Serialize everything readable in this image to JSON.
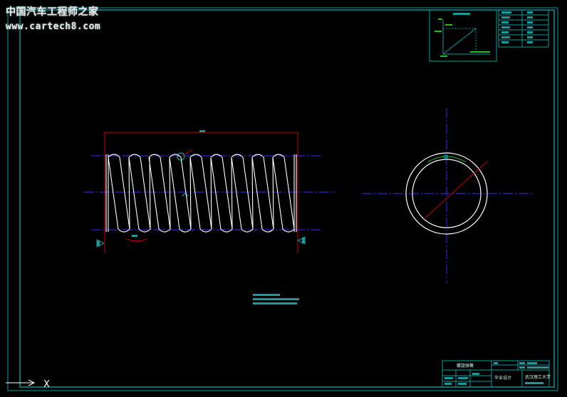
{
  "watermark": {
    "line1": "中国汽车工程师之家",
    "line2": "www.cartech8.com"
  },
  "title_block": {
    "part_name": "螺旋弹簧",
    "design_label": "毕业设计",
    "institution": "武汉理工大学"
  },
  "colors": {
    "frame": "#00a0a0",
    "spring": "#ffffff",
    "centerline": "#3030ff",
    "dimension": "#c00000",
    "text_bar": "#1a9a9a",
    "green": "#20c020",
    "background": "#000000"
  },
  "ucs_icon": {
    "axis_label": "X"
  }
}
